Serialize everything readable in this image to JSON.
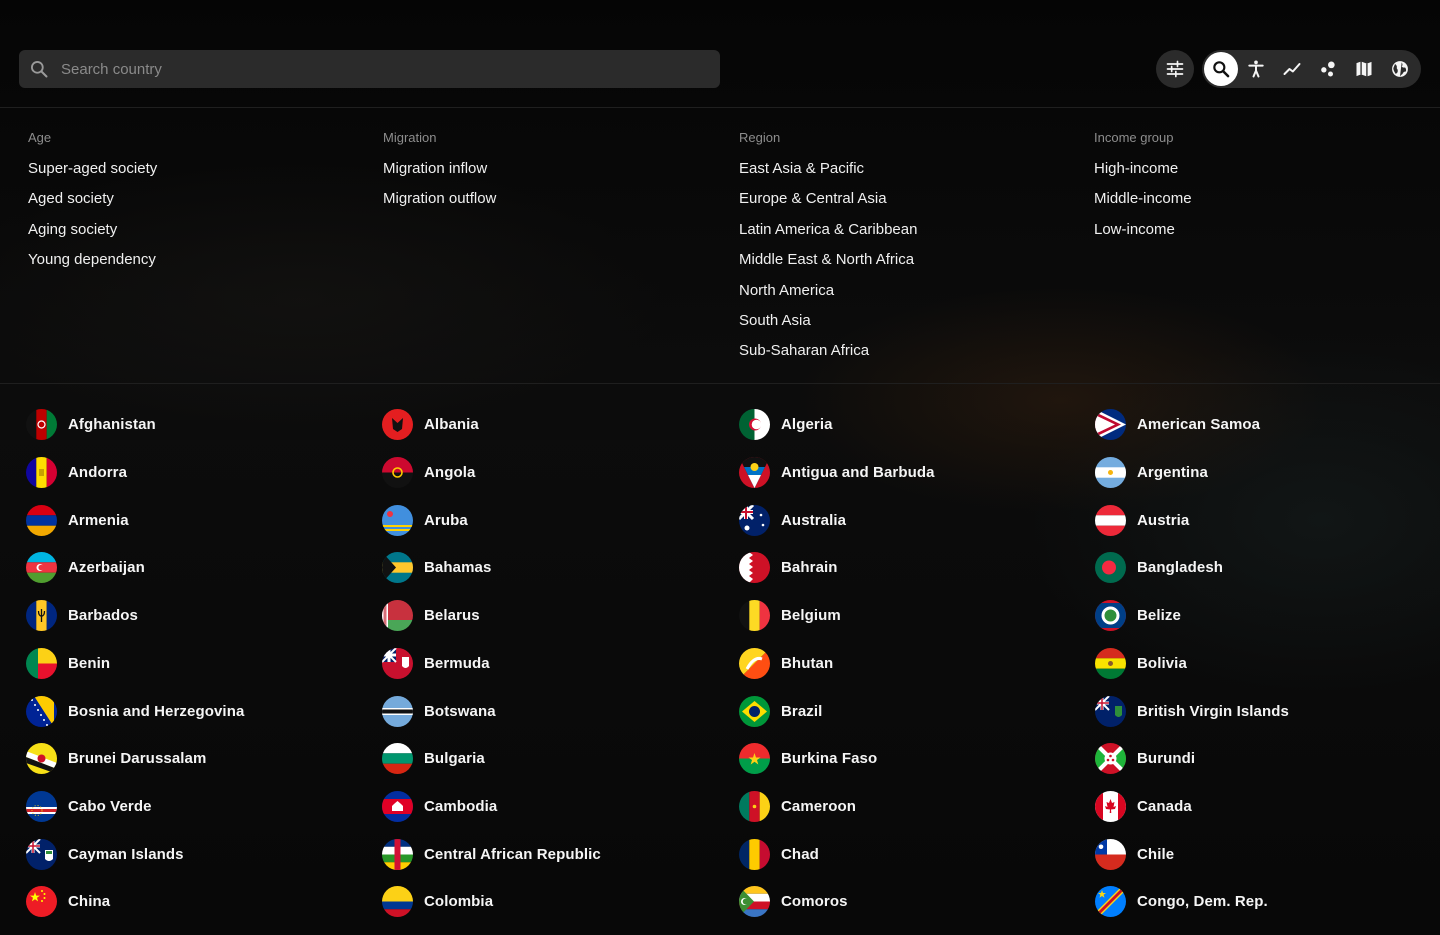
{
  "search": {
    "placeholder": "Search country",
    "value": ""
  },
  "toolbar": {
    "filter_icon": "sliders-icon",
    "buttons": [
      "search-icon",
      "accessibility-icon",
      "trend-icon",
      "scatter-icon",
      "map-icon",
      "globe-icon"
    ],
    "active": "search-icon"
  },
  "filters": {
    "age": {
      "heading": "Age",
      "items": [
        "Super-aged society",
        "Aged society",
        "Aging society",
        "Young dependency"
      ]
    },
    "migration": {
      "heading": "Migration",
      "items": [
        "Migration inflow",
        "Migration outflow"
      ]
    },
    "region": {
      "heading": "Region",
      "items": [
        "East Asia & Pacific",
        "Europe & Central Asia",
        "Latin America & Caribbean",
        "Middle East & North Africa",
        "North America",
        "South Asia",
        "Sub-Saharan Africa"
      ]
    },
    "income": {
      "heading": "Income group",
      "items": [
        "High-income",
        "Middle-income",
        "Low-income"
      ]
    }
  },
  "countries": [
    [
      "Afghanistan",
      "Albania",
      "Algeria",
      "American Samoa"
    ],
    [
      "Andorra",
      "Angola",
      "Antigua and Barbuda",
      "Argentina"
    ],
    [
      "Armenia",
      "Aruba",
      "Australia",
      "Austria"
    ],
    [
      "Azerbaijan",
      "Bahamas",
      "Bahrain",
      "Bangladesh"
    ],
    [
      "Barbados",
      "Belarus",
      "Belgium",
      "Belize"
    ],
    [
      "Benin",
      "Bermuda",
      "Bhutan",
      "Bolivia"
    ],
    [
      "Bosnia and Herzegovina",
      "Botswana",
      "Brazil",
      "British Virgin Islands"
    ],
    [
      "Brunei Darussalam",
      "Bulgaria",
      "Burkina Faso",
      "Burundi"
    ],
    [
      "Cabo Verde",
      "Cambodia",
      "Cameroon",
      "Canada"
    ],
    [
      "Cayman Islands",
      "Central African Republic",
      "Chad",
      "Chile"
    ],
    [
      "China",
      "Colombia",
      "Comoros",
      "Congo, Dem. Rep."
    ]
  ],
  "colors": {
    "background": "#0b0b0b",
    "panel": "#2b2b2b",
    "muted": "#8d8d8d",
    "text": "#f2f2f2"
  }
}
